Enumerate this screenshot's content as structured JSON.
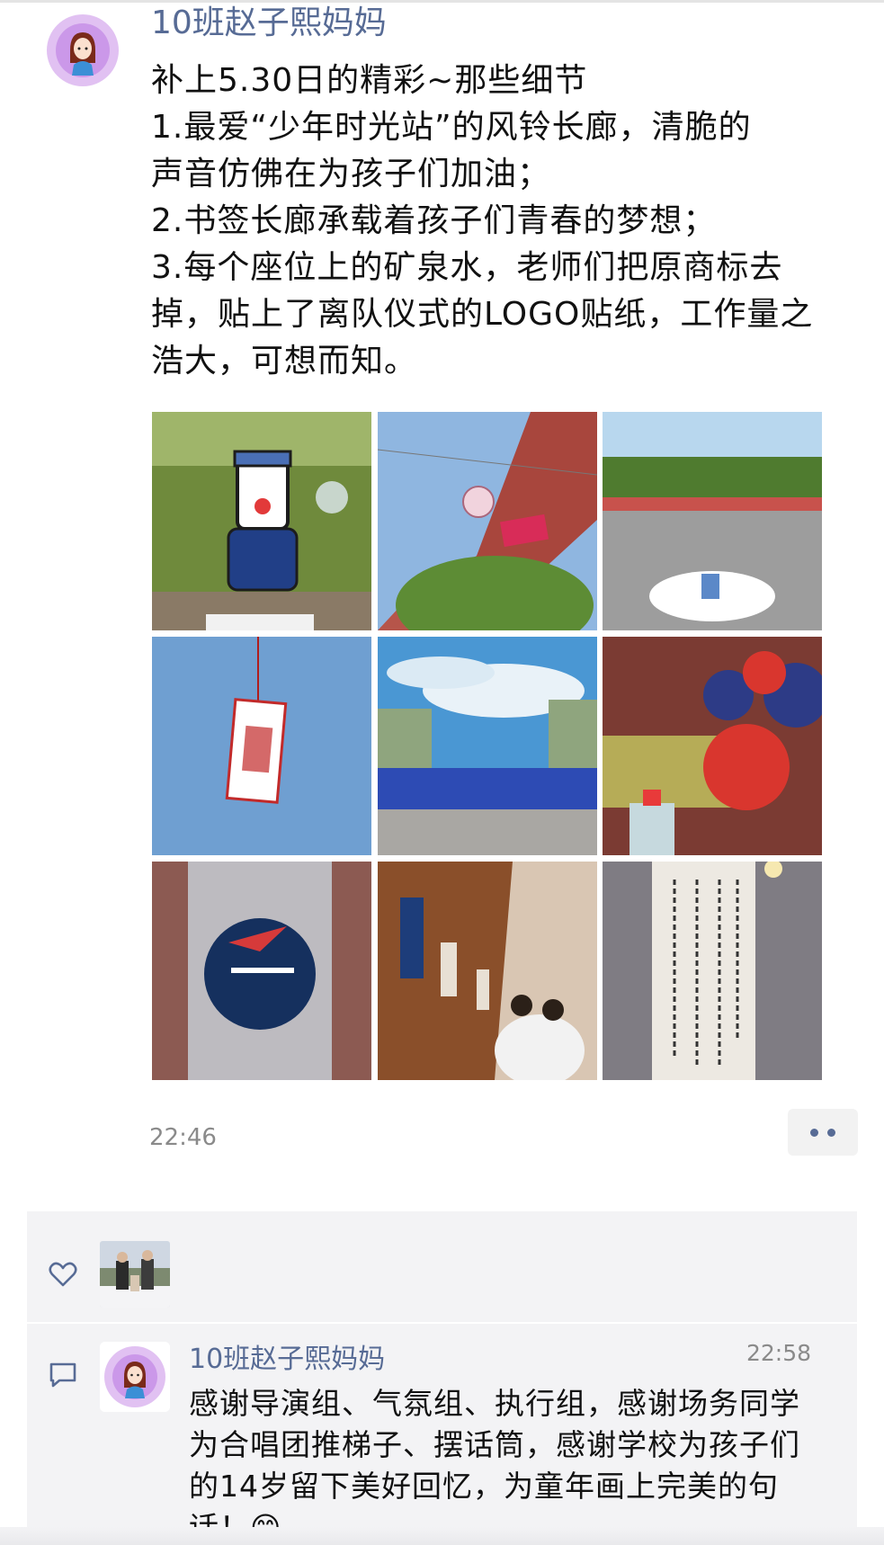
{
  "post": {
    "author": "10班赵子熙妈妈",
    "lines": [
      "补上5.30日的精彩~那些细节",
      "1.最爱“少年时光站”的风铃长廊，清脆的",
      "声音仿佛在为孩子们加油；",
      "2.书签长廊承载着孩子们青春的梦想；",
      "3.每个座位上的矿泉水，老师们把原商标去",
      "掉，贴上了离队仪式的LOGO贴纸，工作量之",
      "浩大，可想而知。"
    ],
    "time": "22:46",
    "photos": [
      "cartoon-figure-on-grass",
      "wind-chime-by-building",
      "walkway-with-logo",
      "hanging-bookmark-sky",
      "banner-under-clouds",
      "balloons-and-bottles",
      "water-bottle-logo-sticker",
      "bookmarks-in-corridor",
      "handwritten-bookmark"
    ]
  },
  "likes": {
    "icon": "heart-icon"
  },
  "comment": {
    "icon": "comment-icon",
    "author": "10班赵子熙妈妈",
    "time": "22:58",
    "lines": [
      "感谢导演组、气氛组、执行组，感谢场务同学",
      "为合唱团推梯子、摆话筒，感谢学校为孩子们",
      "的14岁留下美好回忆，为童年画上完美的句",
      "话！😊"
    ]
  },
  "colors": {
    "name_link": "#576b95",
    "time_gray": "#8a8a8a",
    "panel_bg": "#f3f3f5"
  }
}
